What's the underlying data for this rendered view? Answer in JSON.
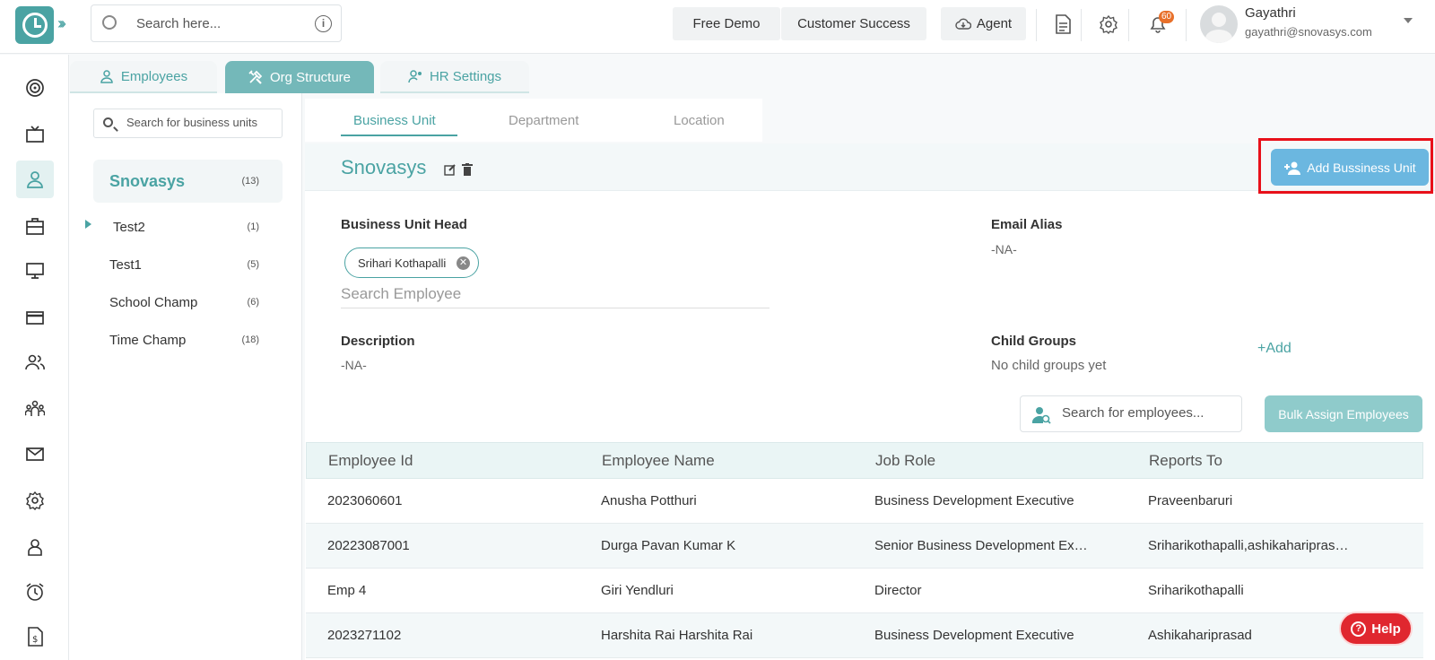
{
  "header": {
    "search_placeholder": "Search here...",
    "free_demo": "Free Demo",
    "customer_success": "Customer Success",
    "agent": "Agent",
    "notification_count": "60",
    "user_name": "Gayathri",
    "user_email": "gayathri@snovasys.com"
  },
  "module_tabs": [
    {
      "label": "Employees"
    },
    {
      "label": "Org Structure"
    },
    {
      "label": "HR Settings"
    }
  ],
  "bu_panel": {
    "search_placeholder": "Search for business units",
    "items": [
      {
        "name": "Snovasys",
        "count": "(13)"
      },
      {
        "name": "Test2",
        "count": "(1)"
      },
      {
        "name": "Test1",
        "count": "(5)"
      },
      {
        "name": "School Champ",
        "count": "(6)"
      },
      {
        "name": "Time Champ",
        "count": "(18)"
      }
    ]
  },
  "sub_tabs": [
    {
      "label": "Business Unit"
    },
    {
      "label": "Department"
    },
    {
      "label": "Location"
    }
  ],
  "detail": {
    "title": "Snovasys",
    "add_button": "Add Bussiness Unit",
    "head_label": "Business Unit Head",
    "head_chip": "Srihari Kothapalli",
    "employee_search_placeholder": "Search Employee",
    "email_alias_label": "Email Alias",
    "email_alias_value": "-NA-",
    "description_label": "Description",
    "description_value": "-NA-",
    "child_groups_label": "Child Groups",
    "child_groups_value": "No child groups yet",
    "add_link": "+Add",
    "search_employees_placeholder": "Search for employees...",
    "bulk_assign": "Bulk Assign Employees"
  },
  "table": {
    "headers": [
      "Employee Id",
      "Employee Name",
      "Job Role",
      "Reports To"
    ],
    "rows": [
      [
        "2023060601",
        "Anusha Potthuri",
        "Business Development Executive",
        "Praveenbaruri"
      ],
      [
        "20223087001",
        "Durga Pavan Kumar K",
        "Senior Business Development Executive",
        "Sriharikothapalli,ashikahariprasad"
      ],
      [
        "Emp 4",
        "Giri Yendluri",
        "Director",
        "Sriharikothapalli"
      ],
      [
        "2023271102",
        "Harshita Rai Harshita Rai",
        "Business Development Executive",
        "Ashikahariprasad"
      ]
    ]
  },
  "help": {
    "label": "Help"
  },
  "colors": {
    "accent": "#4aa3a3",
    "add_button": "#6bb7e0",
    "highlight": "#e8101a",
    "help": "#e0272f"
  }
}
